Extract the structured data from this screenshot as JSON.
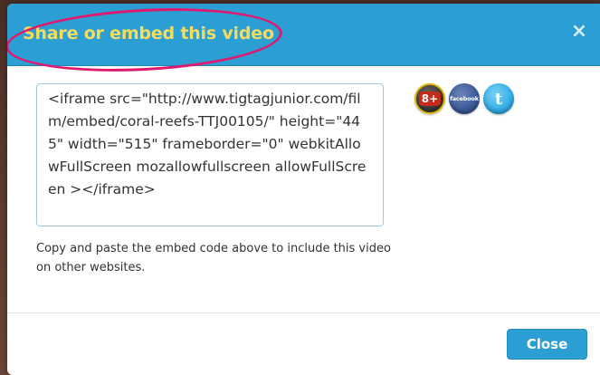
{
  "modal": {
    "title": "Share or embed this video",
    "close_icon": "close-x-icon",
    "close_glyph": "×",
    "embed_code": "<iframe src=\"http://www.tigtagjunior.com/film/embed/coral-reefs-TTJ00105/\" height=\"445\" width=\"515\" frameborder=\"0\" webkitAllowFullScreen mozallowfullscreen allowFullScreen ></iframe>",
    "help_text": "Copy and paste the embed code above to include this video on other websites.",
    "close_label": "Close"
  },
  "social": {
    "gplus_label": "8+",
    "facebook_label": "facebook",
    "twitter_label": "t"
  },
  "colors": {
    "header": "#2b9fd3",
    "title": "#f6dc5e",
    "annotation": "#e0186e",
    "button": "#2b9fd3"
  }
}
